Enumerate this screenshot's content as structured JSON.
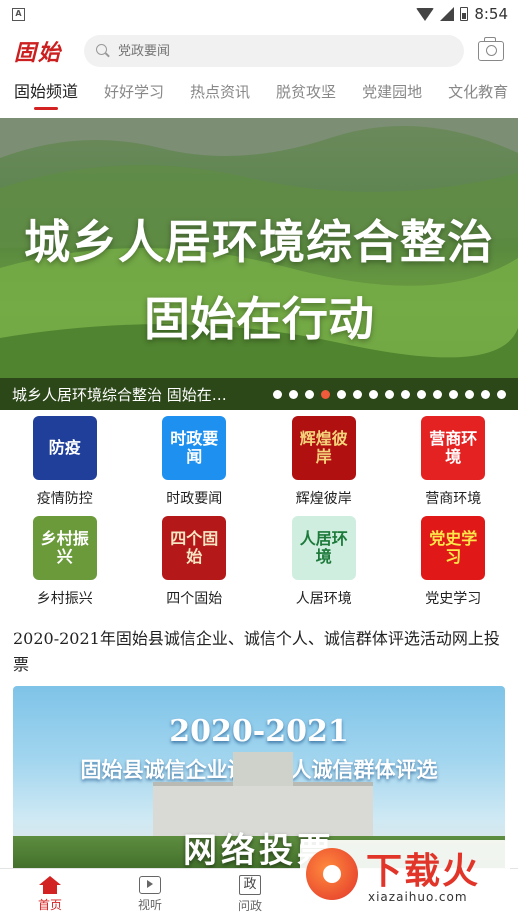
{
  "status_bar": {
    "app_badge": "A",
    "time": "8:54"
  },
  "header": {
    "logo_text": "固始",
    "search_placeholder": "党政要闻"
  },
  "tabs": [
    "固始频道",
    "好好学习",
    "热点资讯",
    "脱贫攻坚",
    "党建园地",
    "文化教育"
  ],
  "active_tab": 0,
  "banner": {
    "title_line1": "城乡人居环境综合整治",
    "title_line2": "固始在行动",
    "caption": "城乡人居环境综合整治 固始在行动",
    "dot_count": 15,
    "active_dot": 3
  },
  "grid": [
    {
      "label": "疫情防控",
      "icon_text": "防疫",
      "icon": "mask-icon",
      "color": "#1f3f9a",
      "text_color": "#ffffff"
    },
    {
      "label": "时政要闻",
      "icon_text": "时政要闻",
      "icon": "news-icon",
      "color": "#1e90f0",
      "text_color": "#ffffff"
    },
    {
      "label": "辉煌彼岸",
      "icon_text": "辉煌彼岸",
      "icon": "glory-icon",
      "color": "#b01010",
      "text_color": "#f5d37a"
    },
    {
      "label": "营商环境",
      "icon_text": "营商环境",
      "icon": "business-icon",
      "color": "#e42222",
      "text_color": "#ffffff"
    },
    {
      "label": "乡村振兴",
      "icon_text": "乡村振兴",
      "icon": "village-icon",
      "color": "#6a9a3a",
      "text_color": "#ffffff"
    },
    {
      "label": "四个固始",
      "icon_text": "四个固始",
      "icon": "four-gushi-icon",
      "color": "#b51818",
      "text_color": "#f7e6c4"
    },
    {
      "label": "人居环境",
      "icon_text": "人居环境",
      "icon": "living-environment-icon",
      "color": "#cfeee0",
      "text_color": "#1d7a3a"
    },
    {
      "label": "党史学习",
      "icon_text": "党史学习",
      "icon": "party-history-icon",
      "color": "#e01818",
      "text_color": "#ffe74a"
    }
  ],
  "article": {
    "title": "2020-2021年固始县诚信企业、诚信个人、诚信群体评选活动网上投票",
    "image_year": "2020-2021",
    "image_subtitle": "固始县诚信企业诚信个人诚信群体评选",
    "image_vote": "网络投票"
  },
  "bottom_nav": [
    {
      "label": "首页",
      "icon": "home-icon"
    },
    {
      "label": "视听",
      "icon": "tv-icon"
    },
    {
      "label": "问政",
      "icon": "zheng-icon",
      "icon_text": "政"
    }
  ],
  "watermark": {
    "brand": "下载火",
    "url": "xiazaihuo.com"
  }
}
